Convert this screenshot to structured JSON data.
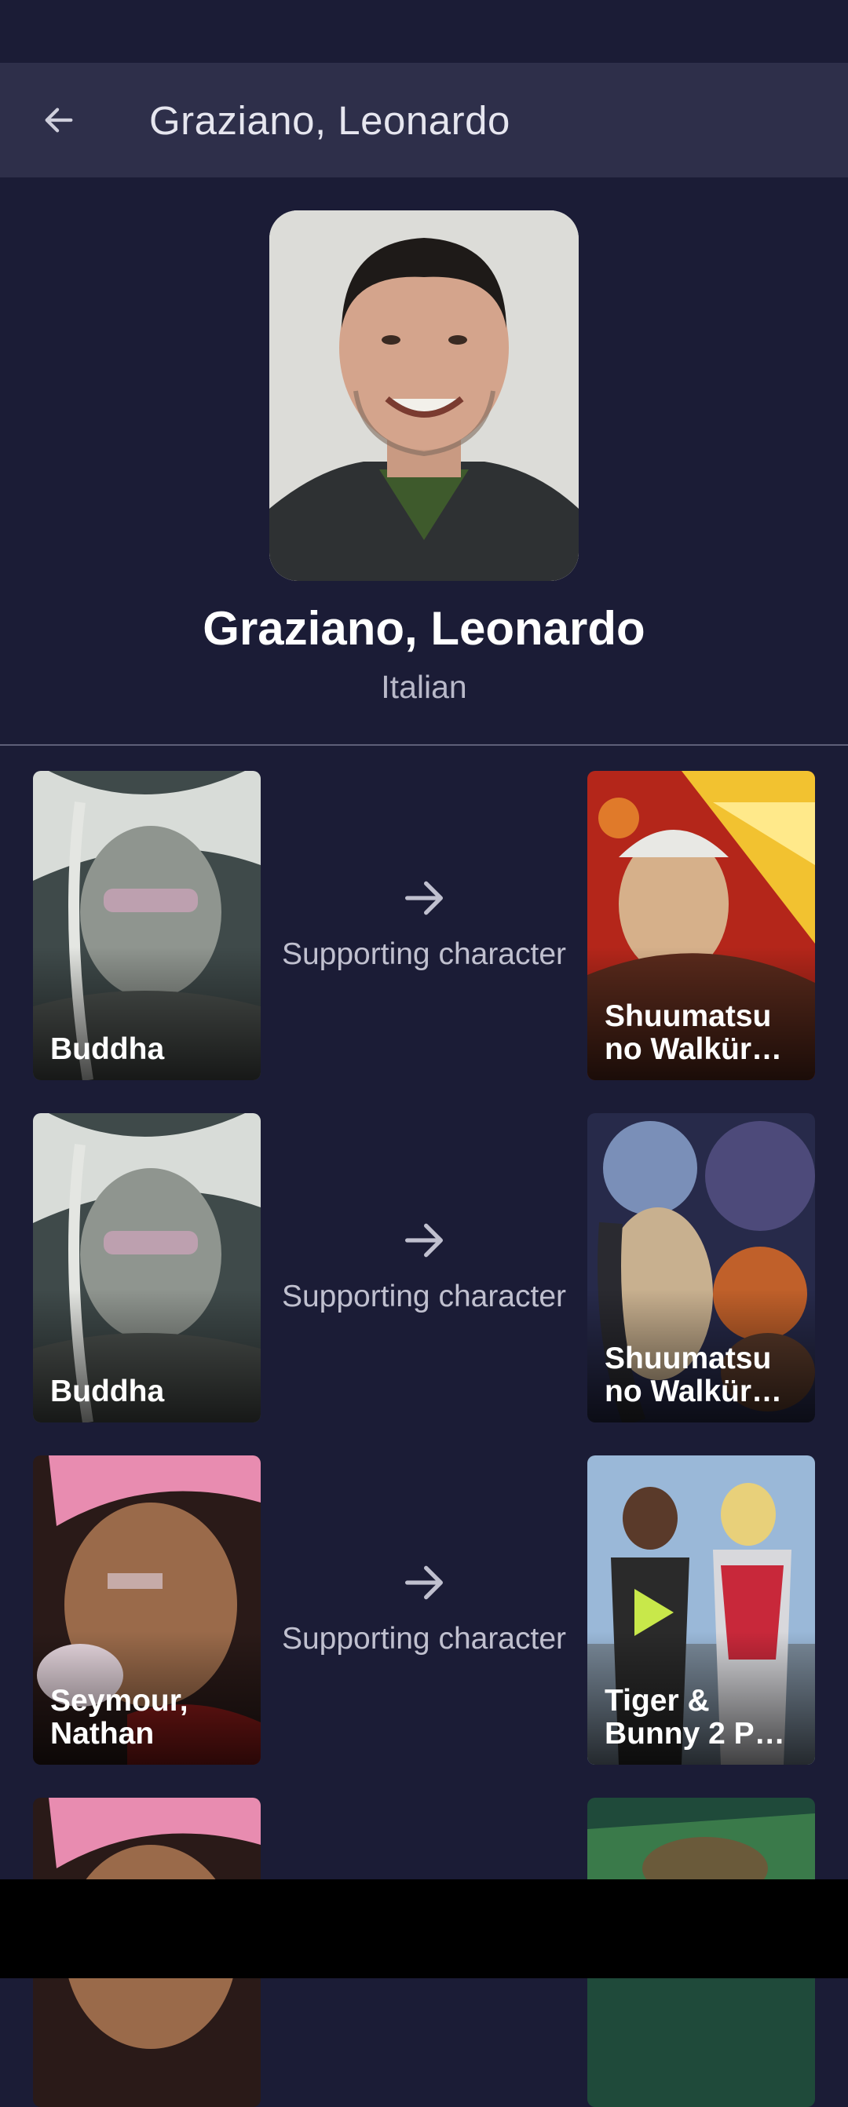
{
  "app_bar": {
    "title": "Graziano, Leonardo"
  },
  "person": {
    "name": "Graziano, Leonardo",
    "language": "Italian"
  },
  "roles": [
    {
      "character": "Buddha",
      "role": "Supporting character",
      "anime": "Shuumatsu no Walkür…"
    },
    {
      "character": "Buddha",
      "role": "Supporting character",
      "anime": "Shuumatsu no Walkür…"
    },
    {
      "character": "Seymour, Nathan",
      "role": "Supporting character",
      "anime": "Tiger & Bunny 2 P…"
    }
  ],
  "colors": {
    "background": "#1b1c36",
    "app_bar": "#2e2f4a",
    "muted_text": "#b9b9c9"
  },
  "icons": {
    "back": "arrow-left-icon",
    "relation": "arrow-right-icon"
  }
}
